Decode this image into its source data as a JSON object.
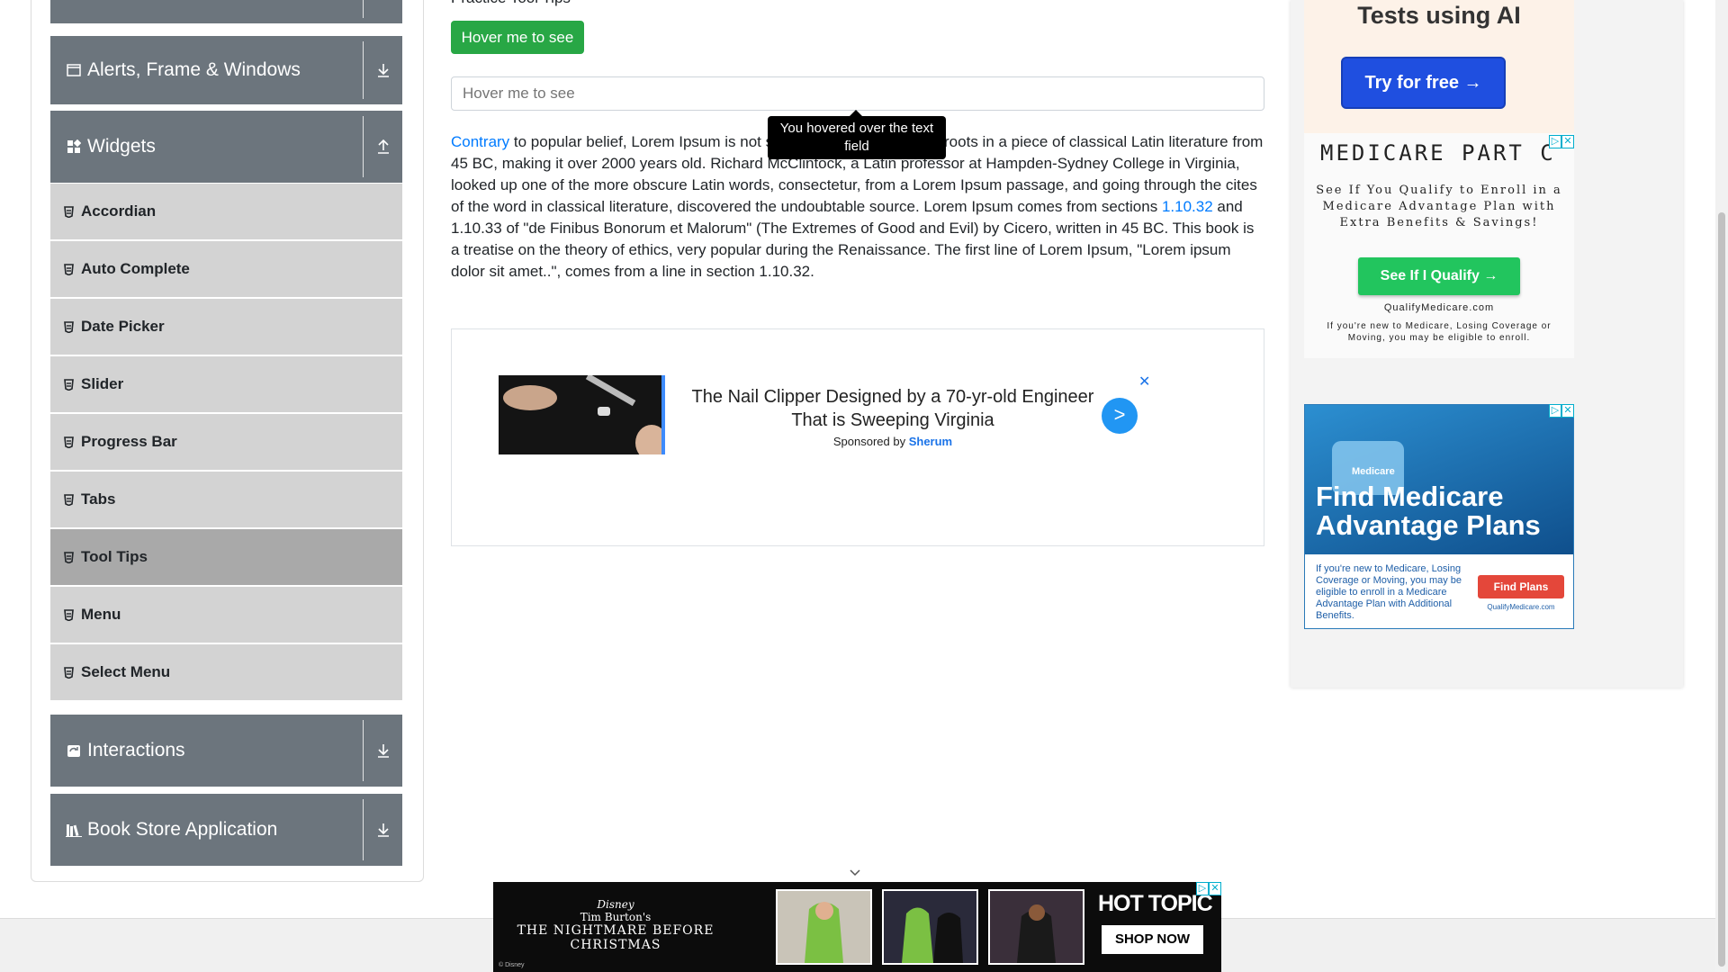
{
  "sidebar": {
    "groups": {
      "alerts": {
        "label": "Alerts, Frame & Windows"
      },
      "widgets": {
        "label": "Widgets"
      },
      "interactions": {
        "label": "Interactions"
      },
      "bookstore": {
        "label": "Book Store Application"
      }
    },
    "items": [
      {
        "label": "Accordian"
      },
      {
        "label": "Auto Complete"
      },
      {
        "label": "Date Picker"
      },
      {
        "label": "Slider"
      },
      {
        "label": "Progress Bar"
      },
      {
        "label": "Tabs"
      },
      {
        "label": "Tool Tips",
        "active": true
      },
      {
        "label": "Menu"
      },
      {
        "label": "Select Menu"
      }
    ]
  },
  "main": {
    "section_title": "Practice Tool Tips",
    "hover_button": "Hover me to see",
    "hover_input_placeholder": "Hover me to see",
    "tooltip": "You hovered over the text field",
    "lorem": {
      "link1": "Contrary",
      "part1": " to popular belief, Lorem Ipsum is not simply random text. It has roots in a piece of classical Latin literature from 45 BC, making it over 2000 years old. Richard McClintock, a Latin professor at Hampden-Sydney College in Virginia, looked up one of the more obscure Latin words, consectetur, from a Lorem Ipsum passage, and going through the cites of the word in classical literature, discovered the undoubtable source. Lorem Ipsum comes from sections ",
      "link2": "1.10.32",
      "part2": " and 1.10.33 of \"de Finibus Bonorum et Malorum\" (The Extremes of Good and Evil) by Cicero, written in 45 BC. This book is a treatise on the theory of ethics, very popular during the Renaissance. The first line of Lorem Ipsum, \"Lorem ipsum dolor sit amet..\", comes from a line in section 1.10.32."
    },
    "ad": {
      "headline": "The Nail Clipper Designed by a 70-yr-old Engineer That is Sweeping Virginia",
      "sponsored_prefix": "Sponsored by",
      "sponsor": "Sherum",
      "next": ">",
      "close": "✕"
    }
  },
  "right_ads": {
    "ai": {
      "title": "Tests using AI",
      "cta": "Try for free →"
    },
    "medicare1": {
      "heading": "MEDICARE PART C",
      "body": "See If You Qualify to Enroll in a Medicare Advantage Plan with Extra Benefits & Savings!",
      "button": "See If I Qualify →",
      "url": "QualifyMedicare.com",
      "footer": "If you're new to Medicare, Losing Coverage or Moving, you may be eligible to enroll."
    },
    "medicare2": {
      "puzzle_label": "Medicare",
      "headline": "Find Medicare Advantage Plans",
      "text": "If you're new to Medicare, Losing Coverage or Moving, you may be eligible to enroll in a Medicare Advantage Plan with Additional Benefits.",
      "button": "Find Plans",
      "url": "QualifyMedicare.com"
    },
    "badge_info": "▷",
    "badge_close": "✕"
  },
  "bottom_ad": {
    "brand_top": "Disney",
    "brand_mid": "Tim Burton's",
    "brand_title": "THE NIGHTMARE BEFORE CHRISTMAS",
    "store": "HOT TOPIC",
    "cta": "SHOP NOW",
    "disclaimer": "© Disney"
  },
  "colors": {
    "sidebar_group": "#6c757d",
    "sidebar_item": "#d3d3d3",
    "sidebar_item_active": "#a9a9a9",
    "success_button": "#28a745",
    "link": "#007bff"
  }
}
